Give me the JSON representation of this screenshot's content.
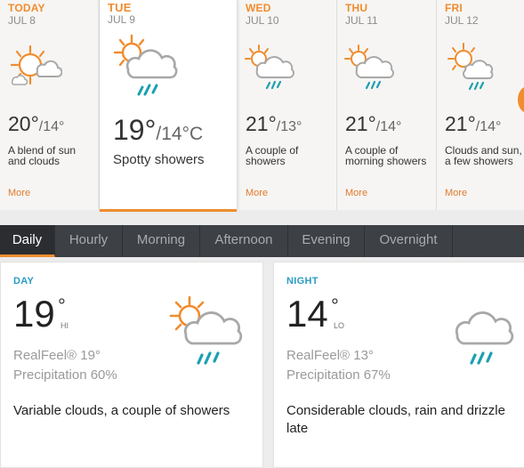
{
  "days": [
    {
      "dow": "TODAY",
      "date": "JUL 8",
      "hi": "20°",
      "lo": "/14°",
      "desc": "A blend of sun and clouds",
      "more": "More",
      "icon": "partly-sunny-icon"
    },
    {
      "dow": "TUE",
      "date": "JUL 9",
      "hi": "19°",
      "lo": "/14°C",
      "desc": "Spotty showers",
      "more": "",
      "icon": "sun-cloud-rain-icon"
    },
    {
      "dow": "WED",
      "date": "JUL 10",
      "hi": "21°",
      "lo": "/13°",
      "desc": "A couple of showers",
      "more": "More",
      "icon": "sun-cloud-rain-icon"
    },
    {
      "dow": "THU",
      "date": "JUL 11",
      "hi": "21°",
      "lo": "/14°",
      "desc": "A couple of morning showers",
      "more": "More",
      "icon": "sun-cloud-rain-icon"
    },
    {
      "dow": "FRI",
      "date": "JUL 12",
      "hi": "21°",
      "lo": "/14°",
      "desc": "Clouds and sun, a few showers",
      "more": "More",
      "icon": "sun-cloud-rain-icon"
    }
  ],
  "tabs": [
    "Daily",
    "Hourly",
    "Morning",
    "Afternoon",
    "Evening",
    "Overnight"
  ],
  "active_tab": "Daily",
  "day_panel": {
    "label": "DAY",
    "temp": "19",
    "deg": "°",
    "hilo": "HI",
    "realfeel": "RealFeel® 19°",
    "precip": "Precipitation 60%",
    "text": "Variable clouds, a couple of showers"
  },
  "night_panel": {
    "label": "NIGHT",
    "temp": "14",
    "deg": "°",
    "hilo": "LO",
    "realfeel": "RealFeel® 13°",
    "precip": "Precipitation 67%",
    "text": "Considerable clouds, rain and drizzle late"
  },
  "colors": {
    "accent": "#f08c2e",
    "label_blue": "#2a9bc4",
    "rain": "#1b9fb0",
    "tabbar": "#3d4045"
  }
}
